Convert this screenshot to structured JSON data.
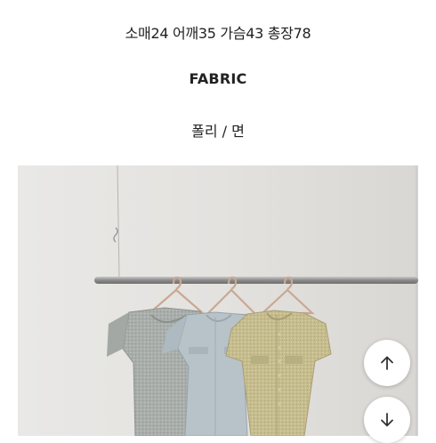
{
  "product": {
    "measurements": "소매24 어깨35 가슴43 총장78",
    "fabric_heading": "FABRIC",
    "fabric_value": "폴리 / 면",
    "photo": {
      "subject": "three short-sleeve tweed dresses on hangers hanging from a clothes rail",
      "dress_colors": [
        "#a9aeab",
        "#b8c3c9",
        "#c6bd8f"
      ]
    }
  },
  "controls": {
    "scroll_up_icon": "arrow-up-icon",
    "scroll_down_icon": "arrow-down-icon"
  }
}
